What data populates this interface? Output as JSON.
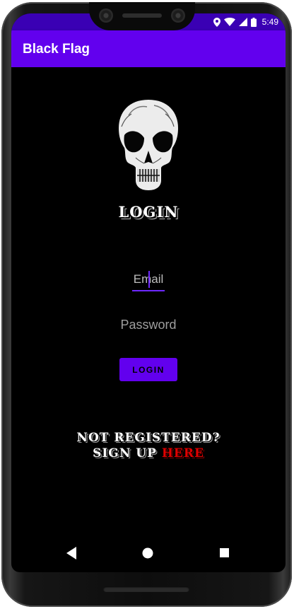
{
  "status_bar": {
    "time": "5:49",
    "icons": [
      "location-icon",
      "wifi-icon",
      "signal-icon",
      "battery-icon"
    ]
  },
  "app_bar": {
    "title": "Black Flag"
  },
  "login": {
    "heading": "LOGIN",
    "email_placeholder": "Email",
    "password_placeholder": "Password",
    "button_label": "LOGIN"
  },
  "register": {
    "line1": "NOT REGISTERED?",
    "line2_prefix": "SIGN UP ",
    "link": "HERE"
  },
  "nav_bar": {
    "buttons": [
      "back",
      "home",
      "recents"
    ]
  },
  "colors": {
    "primary": "#6200ee",
    "status_bar": "#3a00b4",
    "background": "#000000",
    "link": "#e00000"
  }
}
